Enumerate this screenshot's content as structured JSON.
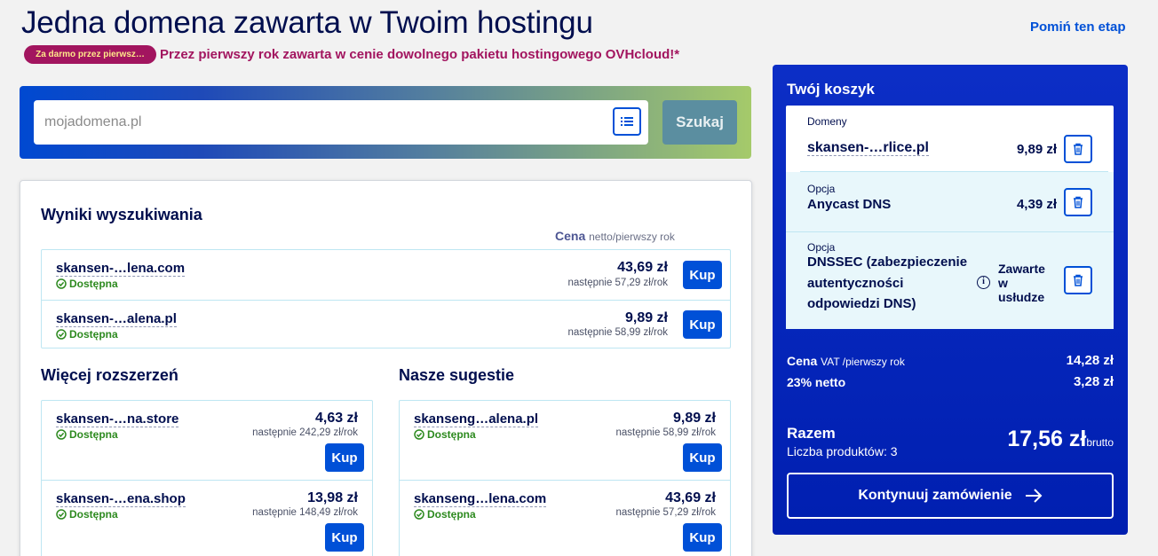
{
  "header": {
    "title": "Jedna domena zawarta w Twoim hostingu",
    "skip_link": "Pomiń ten etap",
    "promo_badge": "Za darmo przez pierwsz…",
    "promo_text": "Przez pierwszy rok zawarta w cenie dowolnego pakietu hostingowego OVHcloud!*"
  },
  "search": {
    "placeholder": "mojadomena.pl",
    "button_label": "Szukaj"
  },
  "results": {
    "title": "Wyniki wyszukiwania",
    "price_label": "Cena",
    "price_sub": "netto/pierwszy rok",
    "items": [
      {
        "name": "skansen-…lena.com",
        "status": "Dostępna",
        "price": "43,69 zł",
        "next": "następnie 57,29 zł/rok",
        "buy": "Kup"
      },
      {
        "name": "skansen-…alena.pl",
        "status": "Dostępna",
        "price": "9,89 zł",
        "next": "następnie 58,99 zł/rok",
        "buy": "Kup"
      }
    ]
  },
  "more_extensions": {
    "title": "Więcej rozszerzeń",
    "items": [
      {
        "name": "skansen-…na.store",
        "status": "Dostępna",
        "price": "4,63 zł",
        "next": "następnie 242,29 zł/rok",
        "buy": "Kup"
      },
      {
        "name": "skansen-…ena.shop",
        "status": "Dostępna",
        "price": "13,98 zł",
        "next": "następnie 148,49 zł/rok",
        "buy": "Kup"
      }
    ]
  },
  "suggestions": {
    "title": "Nasze sugestie",
    "items": [
      {
        "name": "skanseng…alena.pl",
        "status": "Dostępna",
        "price": "9,89 zł",
        "next": "następnie 58,99 zł/rok",
        "buy": "Kup"
      },
      {
        "name": "skanseng…lena.com",
        "status": "Dostępna",
        "price": "43,69 zł",
        "next": "następnie 57,29 zł/rok",
        "buy": "Kup"
      }
    ]
  },
  "cart": {
    "title": "Twój koszyk",
    "items": [
      {
        "label": "Domeny",
        "name": "skansen-…rlice.pl",
        "price": "9,89 zł"
      },
      {
        "label": "Opcja",
        "name": "Anycast DNS",
        "price": "4,39 zł"
      },
      {
        "label": "Opcja",
        "name_lines": [
          "DNSSEC (zabezpieczenie",
          "autentyczności",
          "odpowiedzi DNS)"
        ],
        "included_lines": [
          "Zawarte",
          "w",
          "usłudze"
        ]
      }
    ],
    "price_label": "Cena",
    "price_sub": "VAT /pierwszy rok",
    "price_value": "14,28 zł",
    "vat_label": "23% netto",
    "vat_value": "3,28 zł",
    "total_label": "Razem",
    "products_count": "Liczba produktów: 3",
    "total_value": "17,56 zł",
    "total_sub": "brutto",
    "continue_label": "Kontynuuj zamówienie"
  },
  "colors": {
    "brand_blue": "#0050d7",
    "navy": "#000e4e",
    "promo": "#a2155f",
    "available": "#2d8a1f"
  }
}
